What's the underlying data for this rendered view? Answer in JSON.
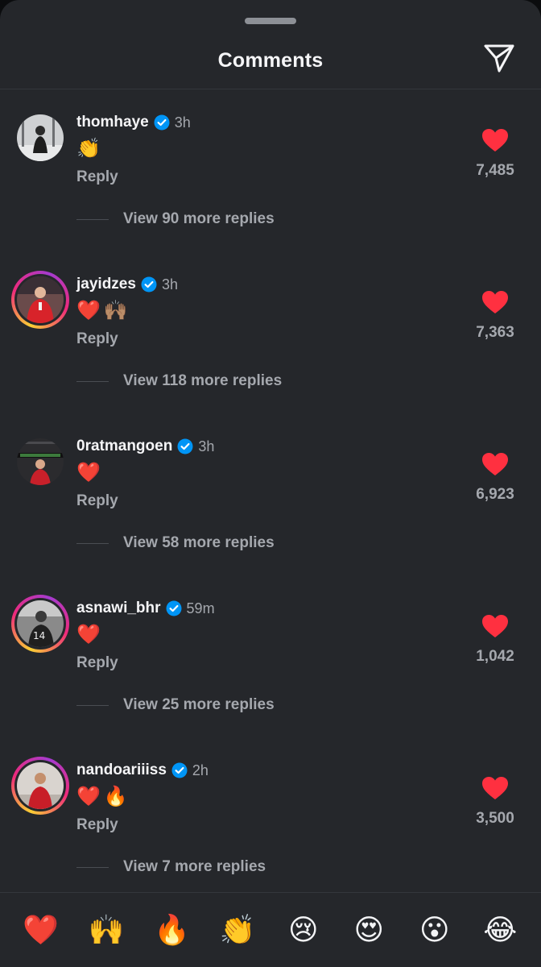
{
  "header": {
    "title": "Comments"
  },
  "comments": [
    {
      "username": "thomhaye",
      "time": "3h",
      "emojis": "👏",
      "reply_label": "Reply",
      "view_replies": "View 90 more replies",
      "likes": "7,485",
      "avatar_ring": false
    },
    {
      "username": "jayidzes",
      "time": "3h",
      "emojis": "❤️🙌🏽",
      "reply_label": "Reply",
      "view_replies": "View 118 more replies",
      "likes": "7,363",
      "avatar_ring": true
    },
    {
      "username": "0ratmangoen",
      "time": "3h",
      "emojis": "❤️",
      "reply_label": "Reply",
      "view_replies": "View 58 more replies",
      "likes": "6,923",
      "avatar_ring": false
    },
    {
      "username": "asnawi_bhr",
      "time": "59m",
      "emojis": "❤️",
      "reply_label": "Reply",
      "view_replies": "View 25 more replies",
      "likes": "1,042",
      "avatar_ring": true
    },
    {
      "username": "nandoariiiss",
      "time": "2h",
      "emojis": "❤️🔥",
      "reply_label": "Reply",
      "view_replies": "View 7 more replies",
      "likes": "3,500",
      "avatar_ring": true
    }
  ],
  "quick_reactions": [
    "❤️",
    "🙌",
    "🔥",
    "👏",
    "😢",
    "😍",
    "😮",
    "😂"
  ],
  "colors": {
    "background": "#25272b",
    "heart": "#ff3040",
    "verified": "#0095f6",
    "muted_text": "#a5a8ae"
  }
}
